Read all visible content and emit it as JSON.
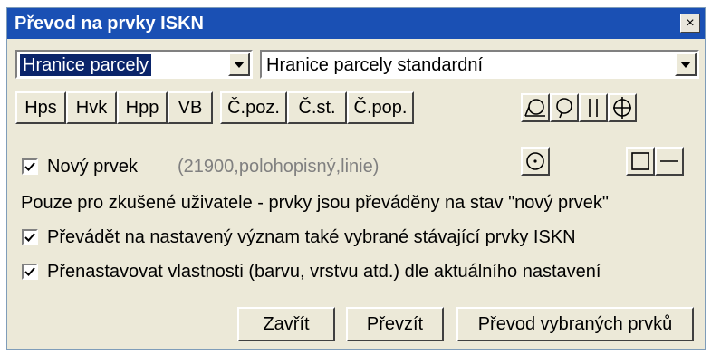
{
  "window": {
    "title": "Převod na prvky ISKN",
    "close_symbol": "×"
  },
  "combos": {
    "left_value": "Hranice parcely",
    "right_value": "Hranice parcely standardní"
  },
  "type_buttons": [
    "Hps",
    "Hvk",
    "Hpp",
    "VB"
  ],
  "number_buttons": [
    "Č.poz.",
    "Č.st.",
    "Č.pop."
  ],
  "shape_icons": [
    "circle-tail-left-icon",
    "circle-tail-right-icon",
    "double-vertical-lines-icon",
    "circle-vertical-line-icon",
    "circle-dot-icon",
    "square-icon",
    "horizontal-line-icon"
  ],
  "new_element": {
    "checked": true,
    "label": "Nový prvek",
    "info": "(21900,polohopisný,linie)"
  },
  "notice": "Pouze pro zkušené uživatele - prvky jsou převáděny na stav \"nový prvek\"",
  "options": [
    {
      "checked": true,
      "label": "Převádět na nastavený význam také vybrané stávající prvky ISKN"
    },
    {
      "checked": true,
      "label": "Přenastavovat vlastnosti (barvu, vrstvu atd.) dle aktuálního nastavení"
    }
  ],
  "footer": {
    "close_label": "Zavřít",
    "take_label": "Převzít",
    "convert_label": "Převod vybraných prvků"
  },
  "colors": {
    "titlebar": "#1a50b4",
    "dialog_bg": "#ece9d8",
    "selection": "#0a246a"
  }
}
